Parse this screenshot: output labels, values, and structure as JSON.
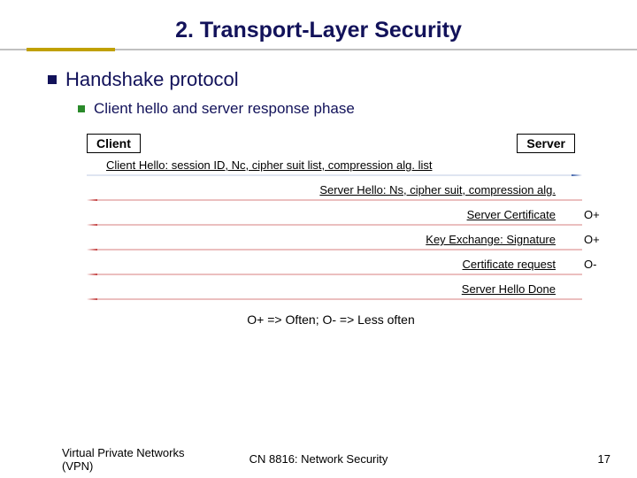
{
  "title": "2. Transport-Layer Security",
  "bullet1": "Handshake protocol",
  "bullet2": "Client hello and server response phase",
  "diagram": {
    "client_label": "Client",
    "server_label": "Server",
    "messages": [
      {
        "dir": "right",
        "text": "Client Hello: session ID, Nc, cipher suit list, compression alg. list",
        "annot": ""
      },
      {
        "dir": "left",
        "text": "Server Hello:  Ns, cipher suit, compression alg.",
        "annot": ""
      },
      {
        "dir": "left",
        "text": "Server Certificate",
        "annot": "O+"
      },
      {
        "dir": "left",
        "text": "Key Exchange: Signature",
        "annot": "O+"
      },
      {
        "dir": "left",
        "text": "Certificate request",
        "annot": "O-"
      },
      {
        "dir": "left",
        "text": "Server Hello Done",
        "annot": ""
      }
    ],
    "legend": "O+ => Often;  O- => Less often"
  },
  "footer": {
    "left": "Virtual Private Networks (VPN)",
    "mid": "CN 8816: Network Security",
    "page": "17"
  }
}
